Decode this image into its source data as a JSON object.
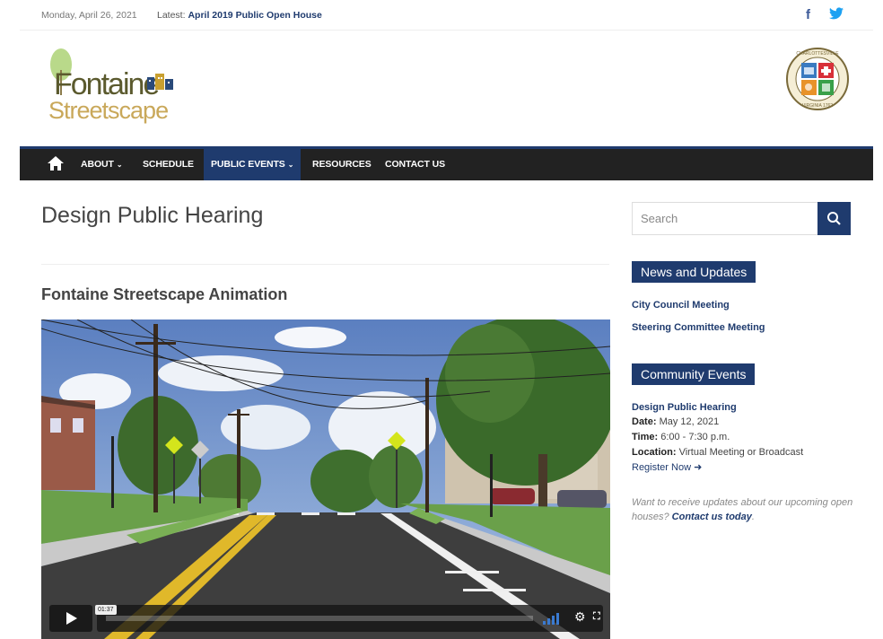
{
  "topbar": {
    "date": "Monday, April 26, 2021",
    "latest_label": "Latest:",
    "latest_link": "April 2019 Public Open House",
    "social": [
      {
        "name": "facebook-icon",
        "glyph": "f"
      },
      {
        "name": "twitter-icon",
        "glyph": "🐦"
      }
    ]
  },
  "brand": {
    "logo_line1": "Fontaine",
    "logo_line2": "Streetscape",
    "seal_text_top": "CHARLOTTESVILLE",
    "seal_text_bottom": "VIRGINIA 1762"
  },
  "nav": {
    "home_icon": "home-icon",
    "items": [
      {
        "label": "ABOUT",
        "has_dropdown": true,
        "active": false
      },
      {
        "label": "SCHEDULE",
        "has_dropdown": false,
        "active": false
      },
      {
        "label": "PUBLIC EVENTS",
        "has_dropdown": true,
        "active": true
      },
      {
        "label": "RESOURCES",
        "has_dropdown": false,
        "active": false
      },
      {
        "label": "CONTACT US",
        "has_dropdown": false,
        "active": false
      }
    ],
    "chevron": "⌄"
  },
  "main": {
    "page_title": "Design Public Hearing",
    "section_title": "Fontaine Streetscape Animation",
    "video": {
      "time": "01:37",
      "progress": 0.0
    }
  },
  "sidebar": {
    "search_placeholder": "Search",
    "news_title": "News and Updates",
    "news_items": [
      "City Council Meeting",
      "Steering Committee Meeting"
    ],
    "events_title": "Community Events",
    "event": {
      "title": "Design Public Hearing",
      "date_label": "Date:",
      "date": "May 12, 2021",
      "time_label": "Time:",
      "time": "6:00 - 7:30 p.m.",
      "location_label": "Location:",
      "location": "Virtual Meeting or Broadcast",
      "register": "Register Now ➜"
    },
    "promo_text": "Want to receive updates about our upcoming open houses?",
    "promo_link": "Contact us today"
  },
  "colors": {
    "brand_navy": "#1f3b6e",
    "nav_bg": "#222222",
    "facebook": "#3b5998",
    "twitter": "#1da1f2"
  }
}
